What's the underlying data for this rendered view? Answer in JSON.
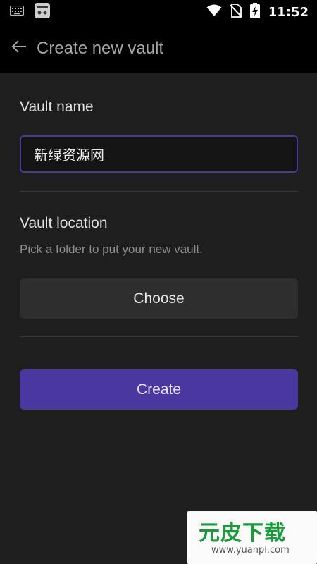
{
  "status_bar": {
    "time": "11:52",
    "icons": [
      "keyboard-icon",
      "app-notification-icon",
      "wifi-icon",
      "no-sim-icon",
      "battery-charging-icon"
    ]
  },
  "header": {
    "title": "Create new vault",
    "back_icon": "arrow-left-icon"
  },
  "vault_name": {
    "label": "Vault name",
    "value": "新绿资源网"
  },
  "vault_location": {
    "label": "Vault location",
    "description": "Pick a folder to put your new vault.",
    "choose_label": "Choose"
  },
  "create_label": "Create",
  "watermark": {
    "text": "元皮下载",
    "url": "www.yuanpi.com"
  },
  "colors": {
    "background": "#1e1e1e",
    "header": "#000000",
    "accent": "#4a38a0",
    "input_border": "#4a3aa0",
    "secondary_button": "#2e2e2e"
  }
}
